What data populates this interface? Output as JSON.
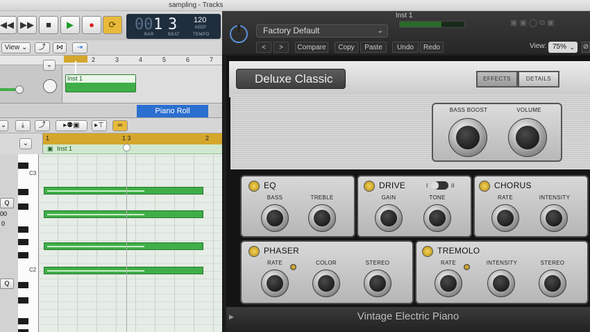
{
  "window": {
    "title": "sampling - Tracks"
  },
  "transport": {
    "rewind": "◀◀",
    "forward": "▶▶",
    "stop": "■",
    "play": "▶",
    "record": "●",
    "cycle": "⟳",
    "lcd": {
      "bar_prefix": "00",
      "bar": "1",
      "beat": "3",
      "bar_label": "BAR",
      "beat_label": "BEAT",
      "tempo": "120",
      "keep": "KEEP",
      "tempo_label": "TEMPO"
    }
  },
  "tracks_toolbar": {
    "view_label": "View ⌄"
  },
  "ruler": {
    "marks": [
      "1",
      "2",
      "3",
      "4",
      "5",
      "6",
      "7"
    ]
  },
  "region": {
    "name": "Inst 1"
  },
  "piano_roll": {
    "tab_label": "Piano Roll",
    "ruler_marks": [
      "1",
      "1 3",
      "2"
    ],
    "region_name": "Inst 1",
    "key_labels": [
      "C3",
      "C2"
    ],
    "q_label": "Q",
    "left_vals": [
      "00",
      "0"
    ]
  },
  "plugin": {
    "title": "Inst 1",
    "preset": "Factory Default",
    "buttons": {
      "prev": "<",
      "next": ">",
      "compare": "Compare",
      "copy": "Copy",
      "paste": "Paste",
      "undo": "Undo",
      "redo": "Redo"
    },
    "view_label": "View:",
    "zoom": "75%"
  },
  "instrument": {
    "name": "Deluxe Classic",
    "tabs": {
      "effects": "EFFECTS",
      "details": "DETAILS"
    },
    "main": {
      "bass_boost": "BASS BOOST",
      "volume": "VOLUME"
    },
    "eq": {
      "title": "EQ",
      "bass": "BASS",
      "treble": "TREBLE"
    },
    "drive": {
      "title": "DRIVE",
      "switch_i": "I",
      "switch_ii": "II",
      "gain": "GAIN",
      "tone": "TONE"
    },
    "chorus": {
      "title": "CHORUS",
      "rate": "RATE",
      "intensity": "INTENSITY"
    },
    "phaser": {
      "title": "PHASER",
      "rate": "RATE",
      "color": "COLOR",
      "stereo": "STEREO"
    },
    "tremolo": {
      "title": "TREMOLO",
      "rate": "RATE",
      "intensity": "INTENSITY",
      "stereo": "STEREO"
    },
    "footer": "Vintage Electric Piano"
  },
  "colors": {
    "region_green": "#3fae48",
    "accent_blue": "#2b6fd0",
    "cycle_yellow": "#d4a72c"
  }
}
